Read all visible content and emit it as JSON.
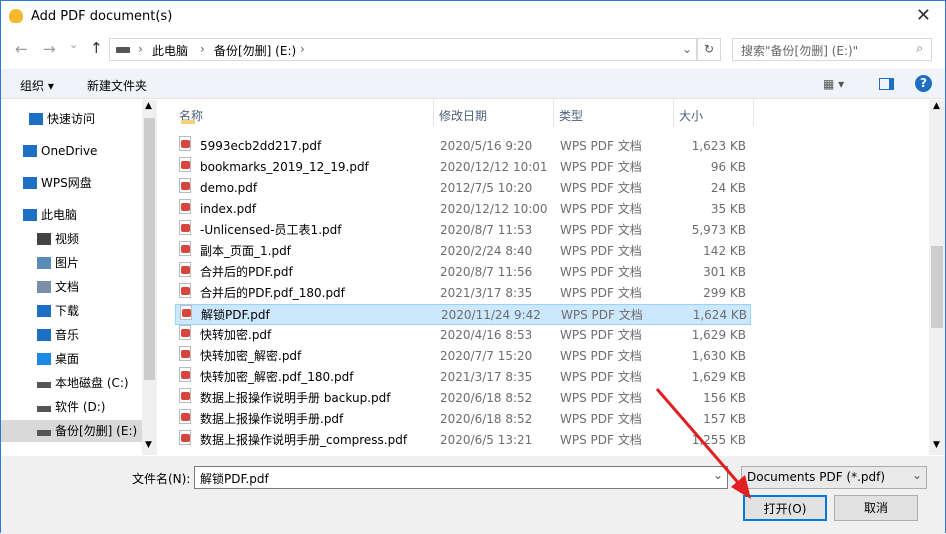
{
  "window": {
    "title": "Add PDF document(s)",
    "close": "✕"
  },
  "nav": {
    "back": "←",
    "forward": "→",
    "recent": "⌄",
    "up": "↑"
  },
  "address": {
    "crumbs": [
      "此电脑",
      "备份[勿删] (E:)"
    ],
    "sep": "›",
    "dropdown": "⌄",
    "refresh": "↻"
  },
  "search": {
    "placeholder": "搜索\"备份[勿删] (E:)\"",
    "icon": "⌕"
  },
  "toolbar": {
    "organize": "组织 ▾",
    "new_folder": "新建文件夹",
    "view": "▦ ▾",
    "help": "?"
  },
  "sidebar": {
    "items": [
      {
        "label": "快速访问",
        "icon": "star-icon"
      },
      {
        "label": "OneDrive",
        "icon": "cloud-icon"
      },
      {
        "label": "WPS网盘",
        "icon": "cloud-icon"
      },
      {
        "label": "此电脑",
        "icon": "computer-icon"
      },
      {
        "label": "视频",
        "icon": "video-icon"
      },
      {
        "label": "图片",
        "icon": "picture-icon"
      },
      {
        "label": "文档",
        "icon": "document-icon"
      },
      {
        "label": "下载",
        "icon": "download-icon"
      },
      {
        "label": "音乐",
        "icon": "music-icon"
      },
      {
        "label": "桌面",
        "icon": "desktop-icon"
      },
      {
        "label": "本地磁盘 (C:)",
        "icon": "drive-icon"
      },
      {
        "label": "软件 (D:)",
        "icon": "drive-icon"
      },
      {
        "label": "备份[勿删] (E:)",
        "icon": "drive-icon"
      }
    ]
  },
  "columns": {
    "name": "名称",
    "date": "修改日期",
    "type": "类型",
    "size": "大小"
  },
  "files": [
    {
      "name": "5993ecb2dd217.pdf",
      "date": "2020/5/16 9:20",
      "type": "WPS PDF 文档",
      "size": "1,623 KB"
    },
    {
      "name": "bookmarks_2019_12_19.pdf",
      "date": "2020/12/12 10:01",
      "type": "WPS PDF 文档",
      "size": "96 KB"
    },
    {
      "name": "demo.pdf",
      "date": "2012/7/5 10:20",
      "type": "WPS PDF 文档",
      "size": "24 KB"
    },
    {
      "name": "index.pdf",
      "date": "2020/12/12 10:00",
      "type": "WPS PDF 文档",
      "size": "35 KB"
    },
    {
      "name": "-Unlicensed-员工表1.pdf",
      "date": "2020/8/7 11:53",
      "type": "WPS PDF 文档",
      "size": "5,973 KB"
    },
    {
      "name": "副本_页面_1.pdf",
      "date": "2020/2/24 8:40",
      "type": "WPS PDF 文档",
      "size": "142 KB"
    },
    {
      "name": "合并后的PDF.pdf",
      "date": "2020/8/7 11:56",
      "type": "WPS PDF 文档",
      "size": "301 KB"
    },
    {
      "name": "合并后的PDF.pdf_180.pdf",
      "date": "2021/3/17 8:35",
      "type": "WPS PDF 文档",
      "size": "299 KB"
    },
    {
      "name": "解锁PDF.pdf",
      "date": "2020/11/24 9:42",
      "type": "WPS PDF 文档",
      "size": "1,624 KB"
    },
    {
      "name": "快转加密.pdf",
      "date": "2020/4/16 8:53",
      "type": "WPS PDF 文档",
      "size": "1,629 KB"
    },
    {
      "name": "快转加密_解密.pdf",
      "date": "2020/7/7 15:20",
      "type": "WPS PDF 文档",
      "size": "1,630 KB"
    },
    {
      "name": "快转加密_解密.pdf_180.pdf",
      "date": "2021/3/17 8:35",
      "type": "WPS PDF 文档",
      "size": "1,629 KB"
    },
    {
      "name": "数据上报操作说明手册 backup.pdf",
      "date": "2020/6/18 8:52",
      "type": "WPS PDF 文档",
      "size": "156 KB"
    },
    {
      "name": "数据上报操作说明手册.pdf",
      "date": "2020/6/18 8:52",
      "type": "WPS PDF 文档",
      "size": "157 KB"
    },
    {
      "name": "数据上报操作说明手册_compress.pdf",
      "date": "2020/6/5 13:21",
      "type": "WPS PDF 文档",
      "size": "1,255 KB"
    }
  ],
  "selected_index": 8,
  "footer": {
    "filename_label": "文件名(N):",
    "filename_value": "解锁PDF.pdf",
    "filter": "Documents PDF (*.pdf)",
    "open": "打开(O)",
    "cancel": "取消"
  }
}
